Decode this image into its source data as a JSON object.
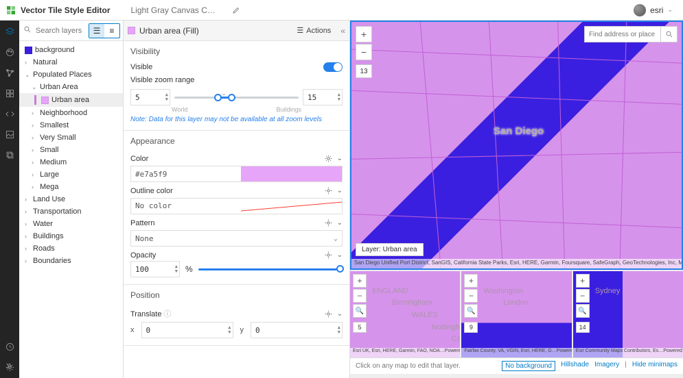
{
  "app": {
    "title": "Vector Tile Style Editor",
    "style_name": "Light Gray Canvas C…"
  },
  "user": {
    "name": "esri"
  },
  "search": {
    "placeholder": "Search layers"
  },
  "layers": {
    "background": "background",
    "groups": [
      {
        "label": "Natural",
        "expanded": false,
        "depth": 1
      },
      {
        "label": "Populated Places",
        "expanded": true,
        "depth": 1
      },
      {
        "label": "Urban Area",
        "expanded": true,
        "depth": 2
      },
      {
        "label": "Urban area",
        "expanded": false,
        "depth": 3,
        "selected": true,
        "swatch": "#e7a5f9"
      },
      {
        "label": "Neighborhood",
        "expanded": false,
        "depth": 2
      },
      {
        "label": "Smallest",
        "expanded": false,
        "depth": 2
      },
      {
        "label": "Very Small",
        "expanded": false,
        "depth": 2
      },
      {
        "label": "Small",
        "expanded": false,
        "depth": 2
      },
      {
        "label": "Medium",
        "expanded": false,
        "depth": 2
      },
      {
        "label": "Large",
        "expanded": false,
        "depth": 2
      },
      {
        "label": "Mega",
        "expanded": false,
        "depth": 2
      },
      {
        "label": "Land Use",
        "expanded": false,
        "depth": 1
      },
      {
        "label": "Transportation",
        "expanded": false,
        "depth": 1
      },
      {
        "label": "Water",
        "expanded": false,
        "depth": 1
      },
      {
        "label": "Buildings",
        "expanded": false,
        "depth": 1
      },
      {
        "label": "Roads",
        "expanded": false,
        "depth": 1
      },
      {
        "label": "Boundaries",
        "expanded": false,
        "depth": 1
      }
    ]
  },
  "props": {
    "title": "Urban area (Fill)",
    "actions": "Actions",
    "visibility": {
      "title": "Visibility",
      "visible": "Visible",
      "on": true,
      "zoom_label": "Visible zoom range",
      "min": "5",
      "max": "15",
      "world": "World",
      "buildings": "Buildings",
      "note": "Note: Data for this layer may not be available at all zoom levels"
    },
    "appearance": {
      "title": "Appearance",
      "color_label": "Color",
      "color_value": "#e7a5f9",
      "outline_label": "Outline color",
      "outline_value": "No color",
      "pattern_label": "Pattern",
      "pattern_value": "None",
      "opacity_label": "Opacity",
      "opacity_value": "100",
      "opacity_unit": "%"
    },
    "position": {
      "title": "Position",
      "translate_label": "Translate",
      "x_label": "x",
      "x_value": "0",
      "y_label": "y",
      "y_value": "0"
    }
  },
  "map": {
    "search_placeholder": "Find address or place",
    "main_label": "San Diego",
    "zoom": "13",
    "layer_chip": "Layer: Urban area",
    "attrib": "San Diego Unified Port District, SanGIS, California State Parks, Esri, HERE, Garmin, Foursquare, SafeGraph, GeoTechnologies, Inc, MET…",
    "powered": "Powered by Esri",
    "minimaps": [
      {
        "zoom": "5",
        "labels": [
          "ENGLAND",
          "Birmingham",
          "WALES",
          "Nottingham",
          "Cardiff"
        ],
        "attrib": "Esri UK, Esri, HERE, Garmin, FAO, NOA…"
      },
      {
        "zoom": "9",
        "labels": [
          "Washington",
          "London"
        ],
        "attrib": "Fairfax County, VA, VGIN, Esri, HERE, G…"
      },
      {
        "zoom": "14",
        "labels": [
          "Sydney"
        ],
        "attrib": "Esri Community Maps Contributors, Es…"
      }
    ],
    "footer_hint": "Click on any map to edit that layer.",
    "footer_links": {
      "nobg": "No background",
      "hill": "Hillshade",
      "img": "Imagery",
      "hide": "Hide minimaps"
    }
  }
}
